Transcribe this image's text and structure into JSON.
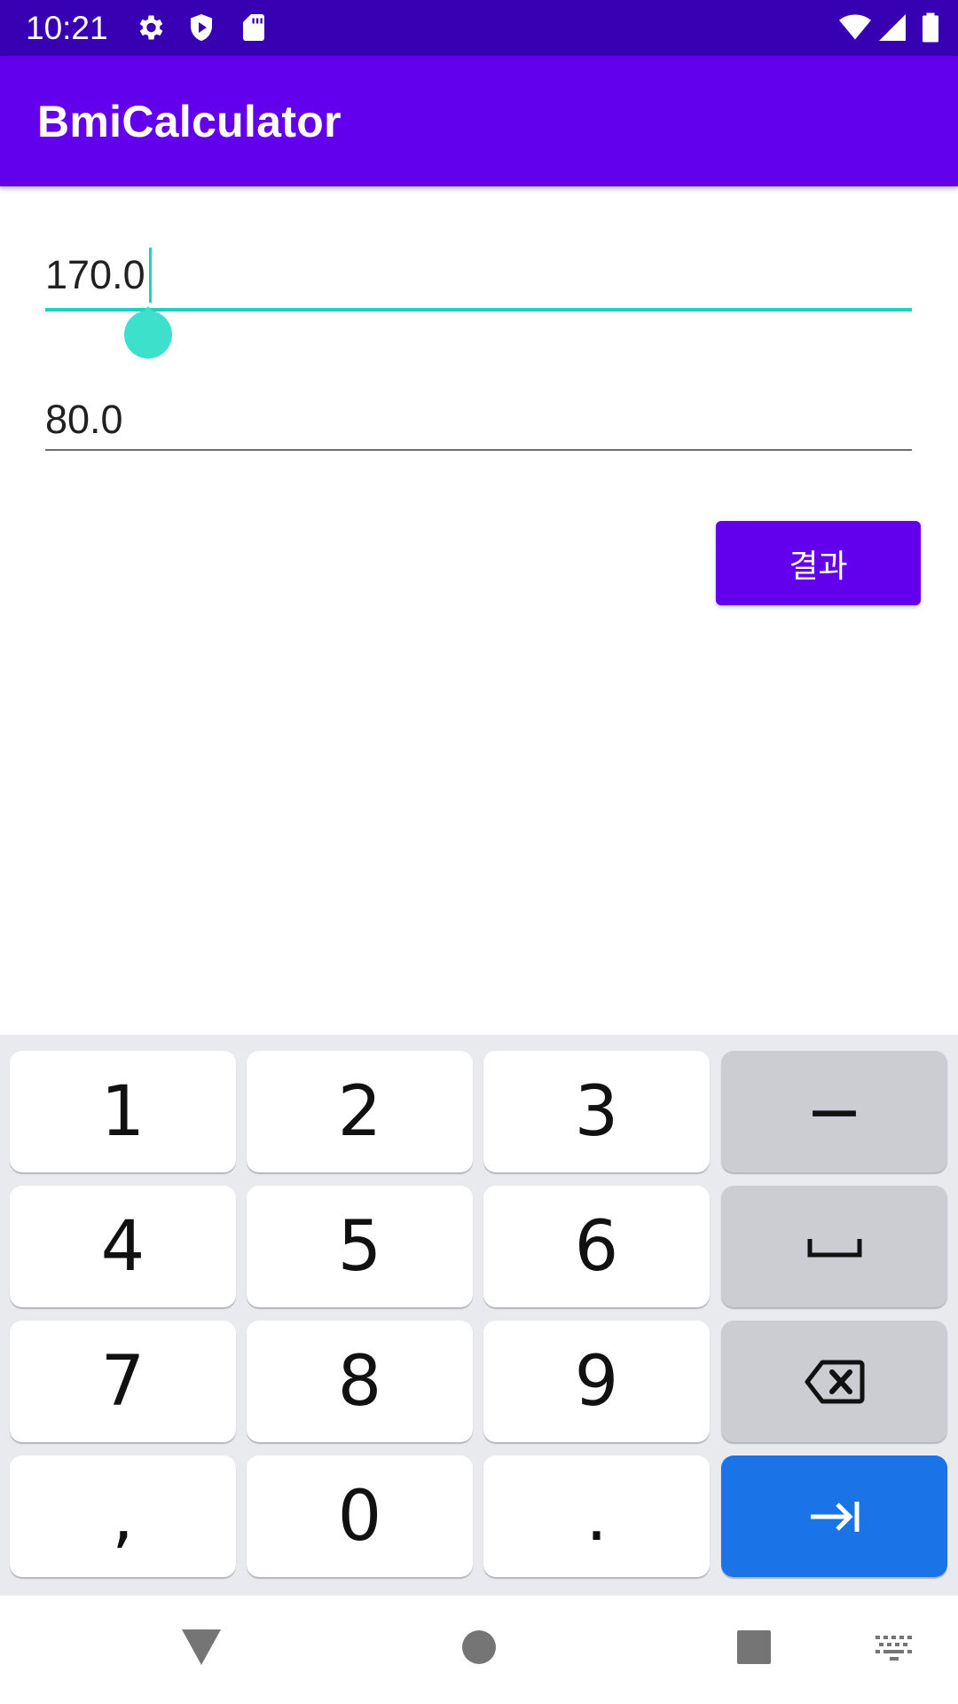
{
  "status_bar": {
    "time": "10:21",
    "left_icons": [
      "gear-icon",
      "shield-play-icon",
      "sd-card-icon"
    ],
    "right_icons": [
      "wifi-icon",
      "signal-icon",
      "battery-icon"
    ]
  },
  "app_bar": {
    "title": "BmiCalculator"
  },
  "form": {
    "height_value": "170.0",
    "weight_value": "80.0",
    "result_button_label": "결과"
  },
  "keyboard": {
    "rows": [
      [
        "1",
        "2",
        "3",
        "−"
      ],
      [
        "4",
        "5",
        "6",
        "space-icon"
      ],
      [
        "7",
        "8",
        "9",
        "backspace-icon"
      ],
      [
        ",",
        "0",
        ".",
        "next-arrow-icon"
      ]
    ]
  },
  "nav_bar": {
    "icons": [
      "back-triangle-icon",
      "home-circle-icon",
      "recents-square-icon",
      "keyboard-switch-icon"
    ]
  },
  "colors": {
    "status_bar": "#3700b3",
    "primary": "#6200ee",
    "accent": "#1ed2c0",
    "keyboard_bg": "#e8eaed",
    "action_key": "#1b73e8"
  }
}
